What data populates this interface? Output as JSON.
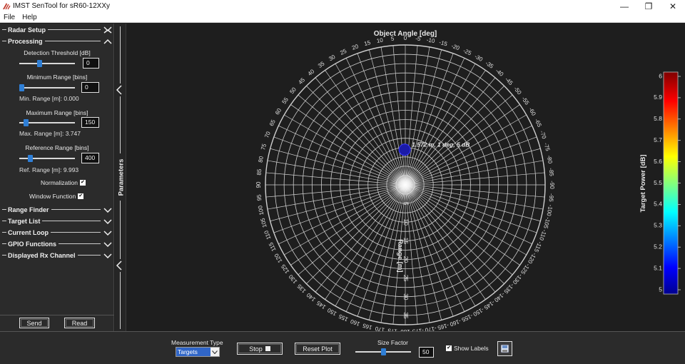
{
  "window": {
    "title": "IMST SenTool for sR60-12XXy",
    "controls": {
      "minimize": "—",
      "restore": "❐",
      "close": "✕"
    }
  },
  "menu": [
    "File",
    "Help"
  ],
  "sections": {
    "radar_setup": "Radar Setup",
    "processing": "Processing",
    "range_finder": "Range Finder",
    "target_list": "Target List",
    "current_loop": "Current Loop",
    "gpio_functions": "GPIO Functions",
    "displayed_rx_channel": "Displayed Rx Channel"
  },
  "processing": {
    "detection_threshold": {
      "label": "Detection Threshold [dB]",
      "value": "0",
      "slider_fraction": 0.35
    },
    "minimum_range": {
      "label": "Minimum Range [bins]",
      "value": "0",
      "slider_fraction": 0.0,
      "info": "Min. Range [m]:  0.000"
    },
    "maximum_range": {
      "label": "Maximum Range [bins]",
      "value": "150",
      "slider_fraction": 0.08,
      "info": "Max. Range [m]:  3.747"
    },
    "reference_range": {
      "label": "Reference Range [bins]",
      "value": "400",
      "slider_fraction": 0.17,
      "info": "Ref. Range [m]:  9.993"
    },
    "normalization": {
      "label": "Normalization",
      "checked": true
    },
    "window_function": {
      "label": "Window Function",
      "checked": true
    }
  },
  "buttons": {
    "send": "Send",
    "read": "Read"
  },
  "side_label": "Parameters",
  "plot": {
    "title": "Object Angle [deg]",
    "range_label": "Range [m]",
    "angle_labels": [
      "0",
      "-5",
      "-10",
      "-15",
      "-20",
      "-25",
      "-30",
      "-35",
      "-40",
      "-45",
      "-50",
      "-55",
      "-60",
      "-65",
      "-70",
      "-75",
      "-80",
      "-85",
      "-90",
      "-95",
      "-100",
      "-105",
      "-110",
      "-115",
      "-120",
      "-125",
      "-130",
      "-135",
      "-140",
      "-145",
      "-150",
      "-155",
      "-160",
      "-165",
      "-170",
      "-175",
      "180",
      "175",
      "170",
      "165",
      "160",
      "155",
      "150",
      "145",
      "140",
      "135",
      "130",
      "125",
      "120",
      "115",
      "110",
      "105",
      "100",
      "95",
      "90",
      "85",
      "80",
      "75",
      "70",
      "65",
      "60",
      "55",
      "50",
      "45",
      "40",
      "35",
      "30",
      "25",
      "20",
      "15",
      "10",
      "5"
    ],
    "range_ticks": [
      "5",
      "10",
      "15",
      "20",
      "25",
      "30",
      "35"
    ],
    "target": {
      "label": "1.572 m, 1 deg, 5 dB",
      "range_m": 1.572,
      "angle_deg": 1,
      "power_db": 5,
      "color": "#1a1aa8"
    }
  },
  "colorbar": {
    "label": "Target Power [dB]",
    "ticks": [
      "6",
      "5.9",
      "5.8",
      "5.7",
      "5.6",
      "5.5",
      "5.4",
      "5.3",
      "5.2",
      "5.1",
      "5"
    ],
    "min": 5,
    "max": 6
  },
  "bottom": {
    "measurement_type_label": "Measurement Type",
    "measurement_type_value": "Targets",
    "stop_label": "Stop",
    "reset_plot_label": "Reset Plot",
    "size_factor_label": "Size Factor",
    "size_factor_value": "50",
    "size_factor_fraction": 0.5,
    "show_labels": {
      "label": "Show Labels",
      "checked": true
    }
  }
}
